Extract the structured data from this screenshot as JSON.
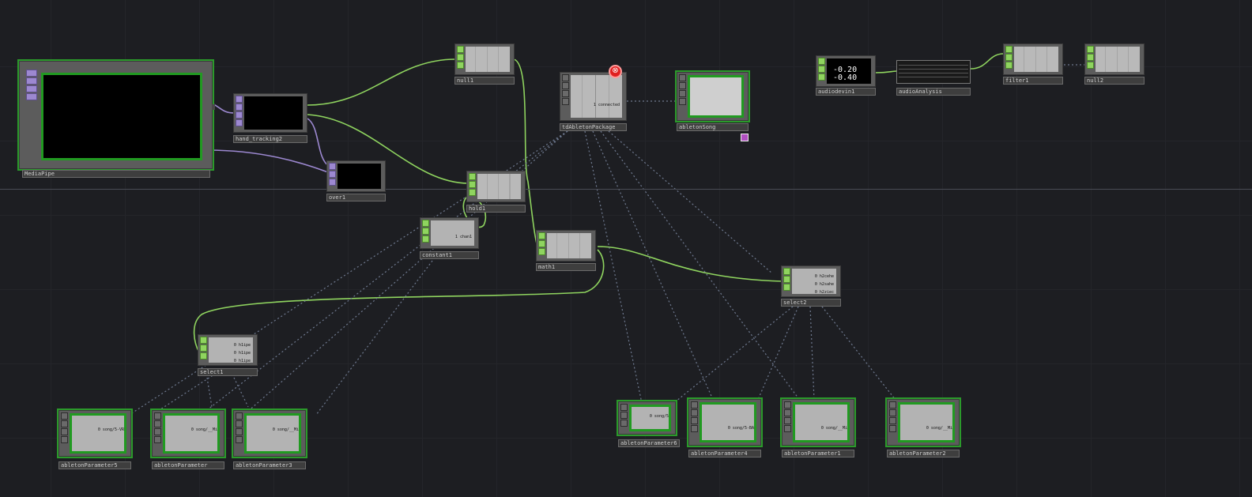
{
  "app": "TouchDesigner network editor",
  "colors": {
    "chop_wire": "#8fd45f",
    "top_wire": "#9c88d0",
    "data_link": "#6f7a90",
    "selected": "#2b9a2b",
    "error": "#e02020"
  },
  "nodes": {
    "mediapipe": {
      "label": "MediaPipe"
    },
    "hand_tracking": {
      "label": "hand_tracking2"
    },
    "over": {
      "label": "over1"
    },
    "null1": {
      "label": "null1"
    },
    "tdableton": {
      "label": "tdAbletonPackage",
      "view_text": "1 connected"
    },
    "abletonsong": {
      "label": "abletonSong"
    },
    "hold": {
      "label": "hold1"
    },
    "constant": {
      "label": "constant1",
      "view_text": "1 chan1"
    },
    "math": {
      "label": "math1"
    },
    "select2": {
      "label": "select2",
      "view_text": "0 h2cehe\n0 h2sahe\n0 h2ziec"
    },
    "select1": {
      "label": "select1",
      "view_text": "0 h1ipe\n0 h1ipe\n0 h1ipe"
    },
    "audiodevin": {
      "label": "audiodevin1",
      "values": [
        "-0.20",
        "-0.40"
      ]
    },
    "audioanalysis": {
      "label": "audioAnalysis"
    },
    "filter": {
      "label": "filter1"
    },
    "null2": {
      "label": "null2"
    },
    "param5": {
      "label": "abletonParameter5",
      "view_text": "0 song/5-VR"
    },
    "param": {
      "label": "abletonParameter",
      "view_text": "0 song/__Mi"
    },
    "param3": {
      "label": "abletonParameter3",
      "view_text": "0 song/__Mi"
    },
    "param6": {
      "label": "abletonParameter6",
      "view_text": "0 song/5"
    },
    "param4": {
      "label": "abletonParameter4",
      "view_text": "0 song/5-BA"
    },
    "param1": {
      "label": "abletonParameter1",
      "view_text": "0 song/__Mi"
    },
    "param2": {
      "label": "abletonParameter2",
      "view_text": "0 song/__Mi"
    }
  }
}
